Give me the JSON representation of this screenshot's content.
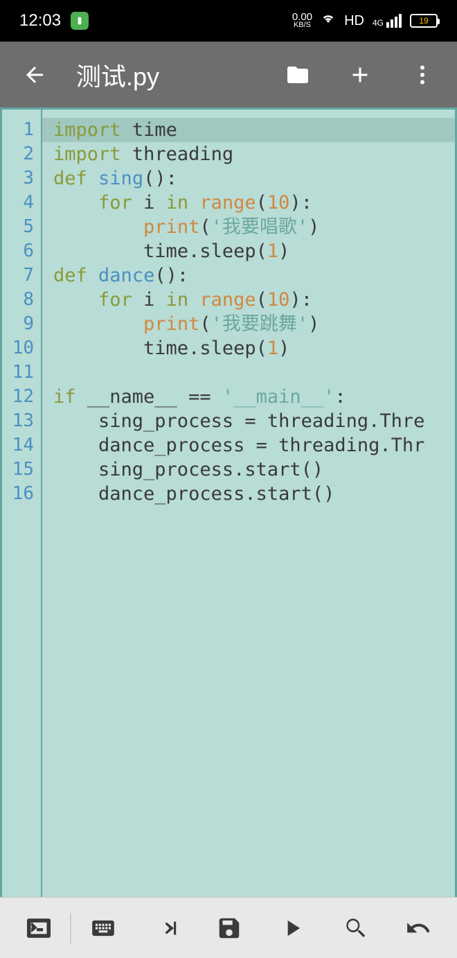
{
  "status": {
    "time": "12:03",
    "speed_top": "0.00",
    "speed_bot": "KB/S",
    "hd": "HD",
    "net": "4G",
    "battery": "19"
  },
  "appbar": {
    "title": "测试.py"
  },
  "editor": {
    "lines": [
      {
        "n": "1",
        "tokens": [
          [
            "kw-import",
            "import"
          ],
          [
            "plain",
            " "
          ],
          [
            "plain",
            "time"
          ]
        ],
        "current": true
      },
      {
        "n": "2",
        "tokens": [
          [
            "kw-import",
            "import"
          ],
          [
            "plain",
            " "
          ],
          [
            "plain",
            "threading"
          ]
        ]
      },
      {
        "n": "3",
        "tokens": [
          [
            "kw-def",
            "def"
          ],
          [
            "plain",
            " "
          ],
          [
            "fn-name",
            "sing"
          ],
          [
            "plain",
            "():"
          ]
        ]
      },
      {
        "n": "4",
        "tokens": [
          [
            "plain",
            "    "
          ],
          [
            "kw-for",
            "for"
          ],
          [
            "plain",
            " i "
          ],
          [
            "kw-in",
            "in"
          ],
          [
            "plain",
            " "
          ],
          [
            "fn-call",
            "range"
          ],
          [
            "plain",
            "("
          ],
          [
            "num",
            "10"
          ],
          [
            "plain",
            "):"
          ]
        ]
      },
      {
        "n": "5",
        "tokens": [
          [
            "plain",
            "        "
          ],
          [
            "fn-call",
            "print"
          ],
          [
            "plain",
            "("
          ],
          [
            "str",
            "'我要唱歌'"
          ],
          [
            "plain",
            ")"
          ]
        ]
      },
      {
        "n": "6",
        "tokens": [
          [
            "plain",
            "        time.sleep("
          ],
          [
            "num",
            "1"
          ],
          [
            "plain",
            ")"
          ]
        ]
      },
      {
        "n": "7",
        "tokens": [
          [
            "kw-def",
            "def"
          ],
          [
            "plain",
            " "
          ],
          [
            "fn-name",
            "dance"
          ],
          [
            "plain",
            "():"
          ]
        ]
      },
      {
        "n": "8",
        "tokens": [
          [
            "plain",
            "    "
          ],
          [
            "kw-for",
            "for"
          ],
          [
            "plain",
            " i "
          ],
          [
            "kw-in",
            "in"
          ],
          [
            "plain",
            " "
          ],
          [
            "fn-call",
            "range"
          ],
          [
            "plain",
            "("
          ],
          [
            "num",
            "10"
          ],
          [
            "plain",
            "):"
          ]
        ]
      },
      {
        "n": "9",
        "tokens": [
          [
            "plain",
            "        "
          ],
          [
            "fn-call",
            "print"
          ],
          [
            "plain",
            "("
          ],
          [
            "str",
            "'我要跳舞'"
          ],
          [
            "plain",
            ")"
          ]
        ]
      },
      {
        "n": "10",
        "tokens": [
          [
            "plain",
            "        time.sleep("
          ],
          [
            "num",
            "1"
          ],
          [
            "plain",
            ")"
          ]
        ]
      },
      {
        "n": "11",
        "tokens": [
          [
            "plain",
            ""
          ]
        ]
      },
      {
        "n": "12",
        "tokens": [
          [
            "kw-if",
            "if"
          ],
          [
            "plain",
            " __name__ == "
          ],
          [
            "str",
            "'__main__'"
          ],
          [
            "plain",
            ":"
          ]
        ]
      },
      {
        "n": "13",
        "tokens": [
          [
            "plain",
            "    sing_process = threading.Thre"
          ]
        ]
      },
      {
        "n": "14",
        "tokens": [
          [
            "plain",
            "    dance_process = threading.Thr"
          ]
        ]
      },
      {
        "n": "15",
        "tokens": [
          [
            "plain",
            "    sing_process.start()"
          ]
        ]
      },
      {
        "n": "16",
        "tokens": [
          [
            "plain",
            "    dance_process.start()"
          ]
        ]
      }
    ]
  }
}
